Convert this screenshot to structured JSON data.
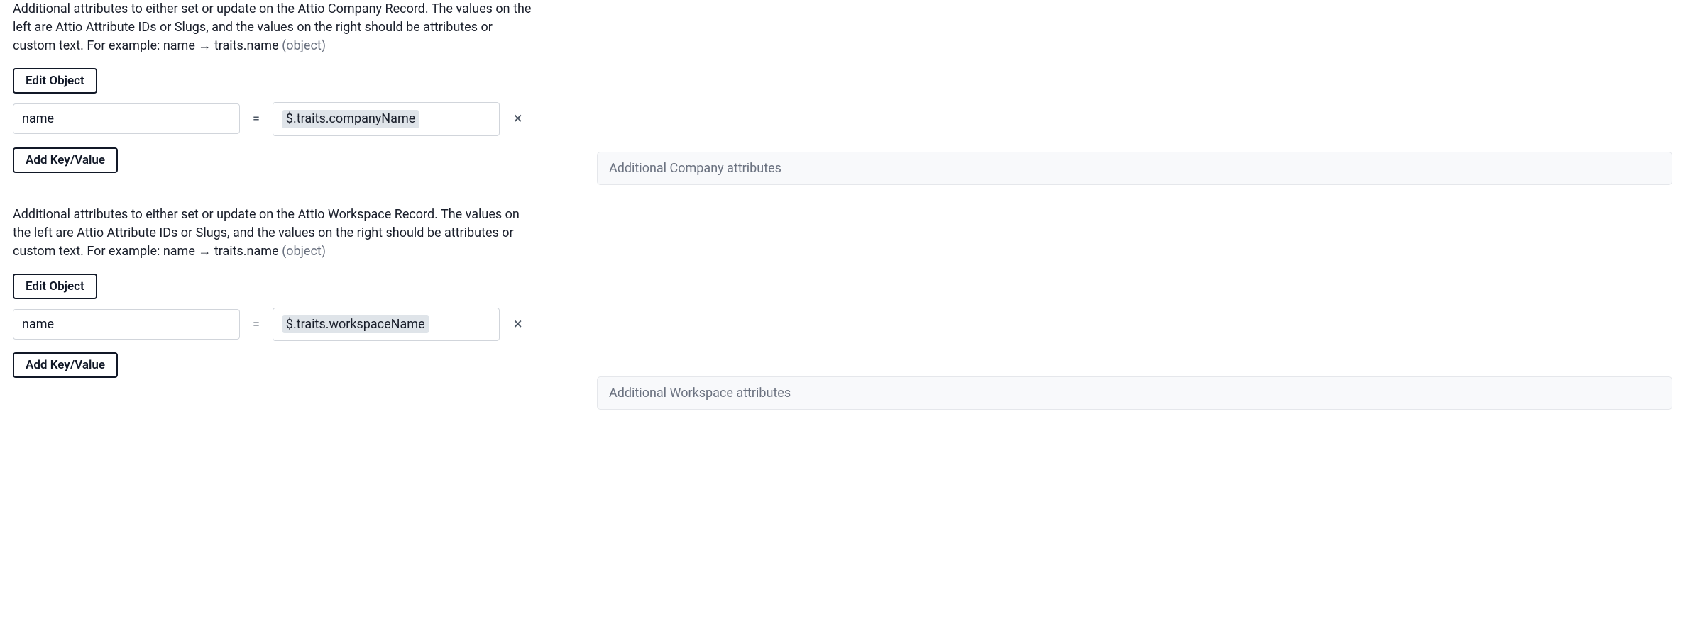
{
  "sections": [
    {
      "description_main": "Additional attributes to either set or update on the Attio Company Record. The values on the left are Attio Attribute IDs or Slugs, and the values on the right should be attributes or custom text. For example: name → traits.name ",
      "description_muted": "(object)",
      "edit_button": "Edit Object",
      "row": {
        "key": "name",
        "equals": "=",
        "value": "$.traits.companyName",
        "close": "×"
      },
      "add_button": "Add Key/Value",
      "right_placeholder": "Additional Company attributes"
    },
    {
      "description_main": "Additional attributes to either set or update on the Attio Workspace Record. The values on the left are Attio Attribute IDs or Slugs, and the values on the right should be attributes or custom text. For example: name → traits.name ",
      "description_muted": "(object)",
      "edit_button": "Edit Object",
      "row": {
        "key": "name",
        "equals": "=",
        "value": "$.traits.workspaceName",
        "close": "×"
      },
      "add_button": "Add Key/Value",
      "right_placeholder": "Additional Workspace attributes"
    }
  ]
}
